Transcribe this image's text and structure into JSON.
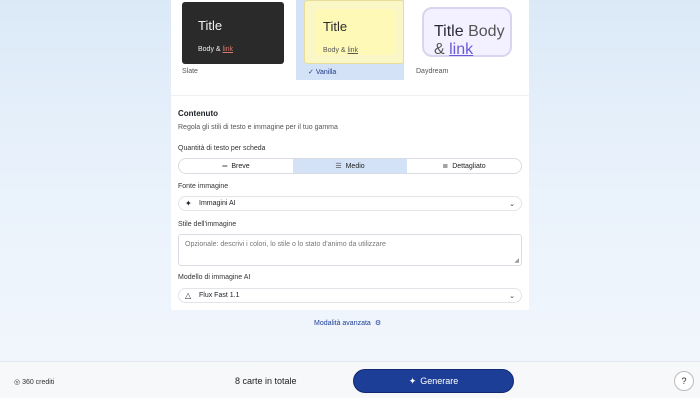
{
  "themes": [
    {
      "name": "Slate",
      "title": "Title",
      "body": "Body &",
      "link": "link"
    },
    {
      "name": "Vanilla",
      "title": "Title",
      "body": "Body &",
      "link": "link",
      "selected": true,
      "check": "✓"
    },
    {
      "name": "Daydream",
      "title": "Title",
      "body": "Body &",
      "link": "link"
    }
  ],
  "content": {
    "title": "Contenuto",
    "subtitle": "Regola gli stili di testo e immagine per il tuo gamma",
    "text_amount_label": "Quantità di testo per scheda",
    "text_amount_options": [
      {
        "label": "Breve",
        "icon": "short-lines-icon"
      },
      {
        "label": "Medio",
        "icon": "medium-lines-icon",
        "selected": true
      },
      {
        "label": "Dettagliato",
        "icon": "detailed-lines-icon"
      }
    ],
    "image_source_label": "Fonte immagine",
    "image_source_value": "Immagini AI",
    "image_style_label": "Stile dell'immagine",
    "image_style_placeholder": "Opzionale: descrivi i colori, lo stile o lo stato d'animo da utilizzare",
    "image_model_label": "Modello di immagine AI",
    "image_model_value": "Flux Fast 1.1"
  },
  "advanced_mode": "Modalità avanzata",
  "footer": {
    "credits": "360 crediti",
    "total": "8 carte in totale",
    "generate": "Generare",
    "help": "?"
  },
  "colors": {
    "accent": "#1c3e96",
    "selected_bg": "#d4e2f7"
  }
}
